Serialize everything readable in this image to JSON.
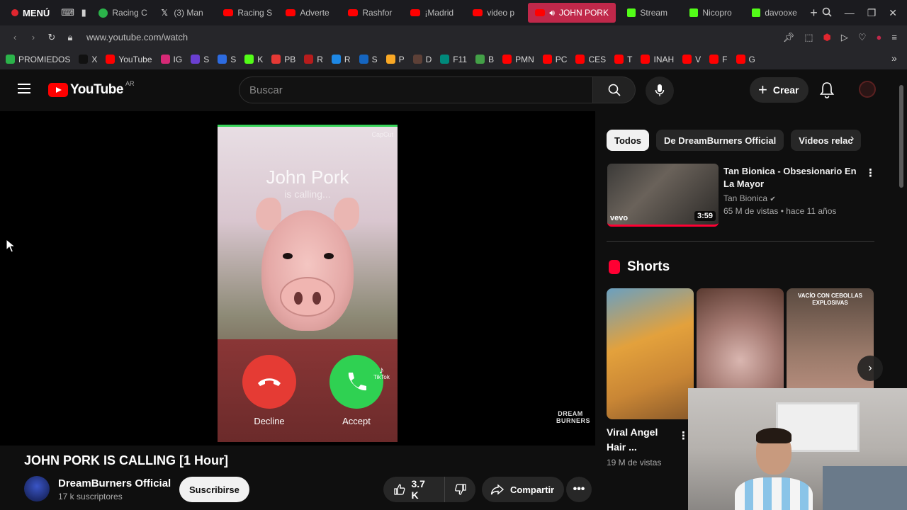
{
  "browser": {
    "menu_label": "MENÚ",
    "tabs": [
      {
        "label": "Racing C",
        "favicon": "green"
      },
      {
        "label": "(3) Man",
        "favicon": "x"
      },
      {
        "label": "Racing S",
        "favicon": "yt"
      },
      {
        "label": "Adverte",
        "favicon": "yt"
      },
      {
        "label": "Rashfor",
        "favicon": "yt"
      },
      {
        "label": "¡Madrid",
        "favicon": "yt"
      },
      {
        "label": "video p",
        "favicon": "yt"
      },
      {
        "label": "JOHN PORK",
        "favicon": "yt",
        "active": true
      },
      {
        "label": "Stream",
        "favicon": "kick"
      },
      {
        "label": "Nicopro",
        "favicon": "kick"
      },
      {
        "label": "davooxe",
        "favicon": "kick"
      }
    ],
    "new_tab_label": "+",
    "url": "www.youtube.com/watch",
    "bookmarks": [
      {
        "label": "PROMIEDOS",
        "color": "#2bb34a"
      },
      {
        "label": "X",
        "color": "#111111"
      },
      {
        "label": "YouTube",
        "color": "#ff0000"
      },
      {
        "label": "IG",
        "color": "#d62976"
      },
      {
        "label": "S",
        "color": "#6a3fd1"
      },
      {
        "label": "S",
        "color": "#2d6be0"
      },
      {
        "label": "K",
        "color": "#53fc18"
      },
      {
        "label": "PB",
        "color": "#e53935"
      },
      {
        "label": "R",
        "color": "#b71c1c"
      },
      {
        "label": "R",
        "color": "#1e88e5"
      },
      {
        "label": "S",
        "color": "#1565c0"
      },
      {
        "label": "P",
        "color": "#f9a825"
      },
      {
        "label": "D",
        "color": "#5d4037"
      },
      {
        "label": "F11",
        "color": "#00897b"
      },
      {
        "label": "B",
        "color": "#43a047"
      },
      {
        "label": "PMN",
        "color": "#ff0000"
      },
      {
        "label": "PC",
        "color": "#ff0000"
      },
      {
        "label": "CES",
        "color": "#ff0000"
      },
      {
        "label": "T",
        "color": "#ff0000"
      },
      {
        "label": "INAH",
        "color": "#ff0000"
      },
      {
        "label": "V",
        "color": "#ff0000"
      },
      {
        "label": "F",
        "color": "#ff0000"
      },
      {
        "label": "G",
        "color": "#ff0000"
      }
    ]
  },
  "header": {
    "logo_text": "YouTube",
    "region": "AR",
    "search_placeholder": "Buscar",
    "create_label": "Crear"
  },
  "video": {
    "caller_name": "John Pork",
    "caller_status": "is calling...",
    "decline_label": "Decline",
    "accept_label": "Accept",
    "tiktok_label": "TikTok",
    "capcut_label": "CapCut",
    "watermark": "DREAM BURNERS",
    "title": "JOHN PORK IS CALLING [1 Hour]"
  },
  "channel": {
    "name": "DreamBurners Official",
    "subscribers": "17 k suscriptores",
    "subscribe_label": "Suscribirse",
    "likes": "3.7 K",
    "share_label": "Compartir",
    "more_label": "•••"
  },
  "sidebar": {
    "chips": [
      {
        "label": "Todos",
        "active": true
      },
      {
        "label": "De DreamBurners Official",
        "active": false
      },
      {
        "label": "Videos relac",
        "active": false
      }
    ],
    "recommended": {
      "title": "Tan Bionica - Obsesionario En La Mayor",
      "channel": "Tan Bionica",
      "meta": "65 M de vistas • hace 11 años",
      "duration": "3:59",
      "badge": "vevo"
    },
    "shorts_heading": "Shorts",
    "shorts_caption_3": "VACÍO CON CEBOLLAS EXPLOSIVAS",
    "short_title": "Viral Angel Hair ...",
    "short_views": "19 M de vistas"
  }
}
